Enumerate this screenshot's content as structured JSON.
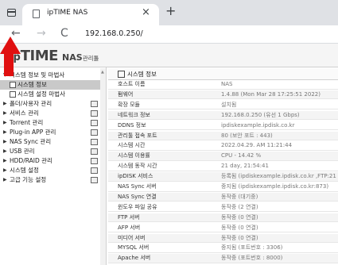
{
  "browser": {
    "tab_title": "ipTIME NAS",
    "tab_close": "×",
    "new_tab": "+",
    "back": "←",
    "forward": "→",
    "reload": "C",
    "url": "192.168.0.250/"
  },
  "header": {
    "logo_ip": "ip",
    "logo_time": "TIME",
    "logo_nas": "NAS",
    "logo_manager": "관리툴"
  },
  "accent_colors": {
    "arrow": "#e01010",
    "selected_row": "#c9c9c9"
  },
  "sidebar": {
    "items": [
      {
        "label": "시스템 정보 및 마법사",
        "arrow": "▼"
      },
      {
        "label": "시스템 정보",
        "sub": true,
        "selected": true
      },
      {
        "label": "시스템 설정 마법사",
        "sub": true
      },
      {
        "label": "폴더/사용자 관리",
        "arrow": "▶"
      },
      {
        "label": "서비스 관리",
        "arrow": "▶"
      },
      {
        "label": "Torrent 관리",
        "arrow": "▶"
      },
      {
        "label": "Plug-in APP 관리",
        "arrow": "▶"
      },
      {
        "label": "NAS Sync 관리",
        "arrow": "▶"
      },
      {
        "label": "USB 관리",
        "arrow": "▶"
      },
      {
        "label": "HDD/RAID 관리",
        "arrow": "▶"
      },
      {
        "label": "시스템 설정",
        "arrow": "▶"
      },
      {
        "label": "고급 기능 설정",
        "arrow": "▶"
      }
    ]
  },
  "main": {
    "title": "시스템 정보",
    "rows": [
      {
        "key": "호스트 이름",
        "value": "NAS"
      },
      {
        "key": "펌웨어",
        "value": "1.4.88 (Mon Mar 28 17:25:51 2022)"
      },
      {
        "key": "확장 모듈",
        "value": "설치됨"
      },
      {
        "key": "네트워크 정보",
        "value": "192.168.0.250 (유선 1 Gbps)"
      },
      {
        "key": "DDNS 정보",
        "value": "ipdiskexample.ipdisk.co.kr"
      },
      {
        "key": "관리툴 접속 포트",
        "value": "80 (보안 포트 : 443)"
      },
      {
        "key": "시스템 시간",
        "value": "2022.04.29. AM 11:21:44"
      },
      {
        "key": "시스템 이용률",
        "value": "CPU - 14.42 %"
      },
      {
        "key": "시스템 동작 시간",
        "value": "21 day, 21:54:41"
      },
      {
        "key": "ipDISK 서비스",
        "value": "등록됨 (ipdiskexample.ipdisk.co.kr ,FTP:21"
      },
      {
        "key": "NAS Sync 서버",
        "value": "중지됨 (ipdiskexample.ipdisk.co.kr:873)"
      },
      {
        "key": "NAS Sync 연결",
        "value": "동작중 (대기중)"
      },
      {
        "key": "윈도우 파일 공유",
        "value": "동작중 (2 연결)"
      },
      {
        "key": "FTP 서버",
        "value": "동작중 (0 연결)"
      },
      {
        "key": "AFP 서버",
        "value": "동작중 (0 연결)"
      },
      {
        "key": "미디어 서버",
        "value": "동작중 (0 연결)"
      },
      {
        "key": "MYSQL 서버",
        "value": "중지됨 (포트번호 : 3306)"
      },
      {
        "key": "Apache 서버",
        "value": "동작중 (포트번호 : 8000)"
      }
    ]
  }
}
